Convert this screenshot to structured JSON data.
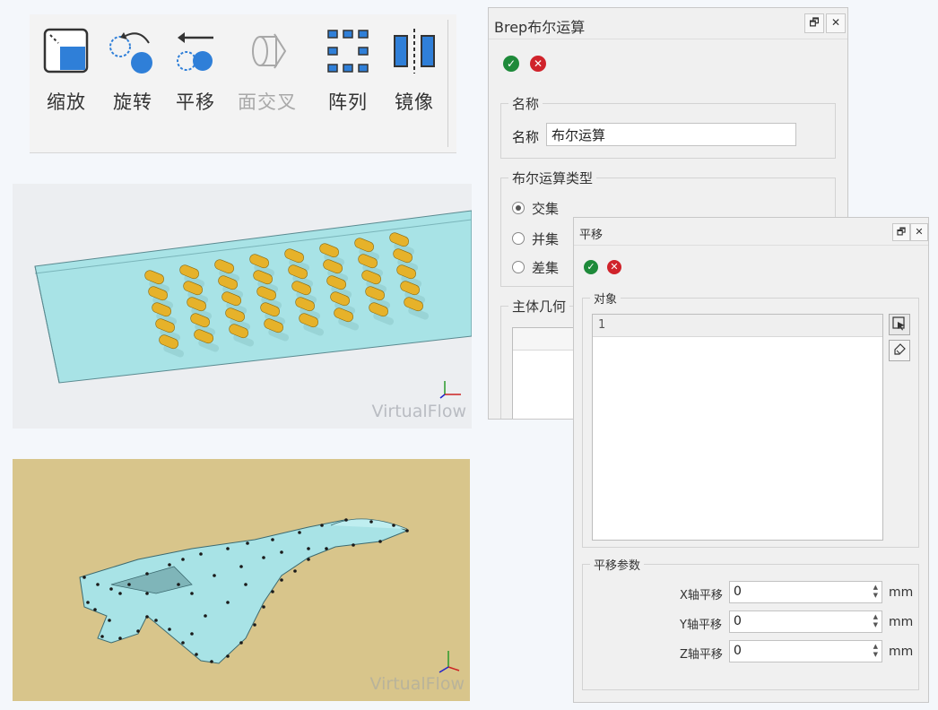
{
  "toolbar": {
    "items": [
      {
        "label": "缩放",
        "icon": "zoom-icon",
        "enabled": true
      },
      {
        "label": "旋转",
        "icon": "rotate-icon",
        "enabled": true
      },
      {
        "label": "平移",
        "icon": "translate-icon",
        "enabled": true
      },
      {
        "label": "面交叉",
        "icon": "face-intersect-icon",
        "enabled": false
      },
      {
        "label": "阵列",
        "icon": "array-icon",
        "enabled": true
      },
      {
        "label": "镜像",
        "icon": "mirror-icon",
        "enabled": true
      }
    ]
  },
  "viewport1": {
    "watermark": "VirtualFlow",
    "background": "#eceef1",
    "plate_color": "#a8e3e6",
    "cylinder_color": "#e6b22a"
  },
  "viewport2": {
    "watermark": "VirtualFlow",
    "background": "#d8c58b",
    "model_color": "#a8e3e6"
  },
  "brep_dialog": {
    "title": "Brep布尔运算",
    "name_group": {
      "legend": "名称",
      "label": "名称",
      "value": "布尔运算"
    },
    "type_group": {
      "legend": "布尔运算类型",
      "options": [
        {
          "label": "交集",
          "selected": true
        },
        {
          "label": "并集",
          "selected": false
        },
        {
          "label": "差集",
          "selected": false
        }
      ]
    },
    "main_geometry_legend": "主体几何"
  },
  "move_dialog": {
    "title": "平移",
    "object_group": {
      "legend": "对象",
      "rows": [
        "1"
      ]
    },
    "param_group": {
      "legend": "平移参数",
      "params": [
        {
          "label": "X轴平移",
          "value": "0",
          "unit": "mm"
        },
        {
          "label": "Y轴平移",
          "value": "0",
          "unit": "mm"
        },
        {
          "label": "Z轴平移",
          "value": "0",
          "unit": "mm"
        }
      ]
    }
  },
  "colors": {
    "ok": "#1e8a3a",
    "cancel": "#d0232b",
    "toolbar_blue": "#2f7fd8"
  }
}
